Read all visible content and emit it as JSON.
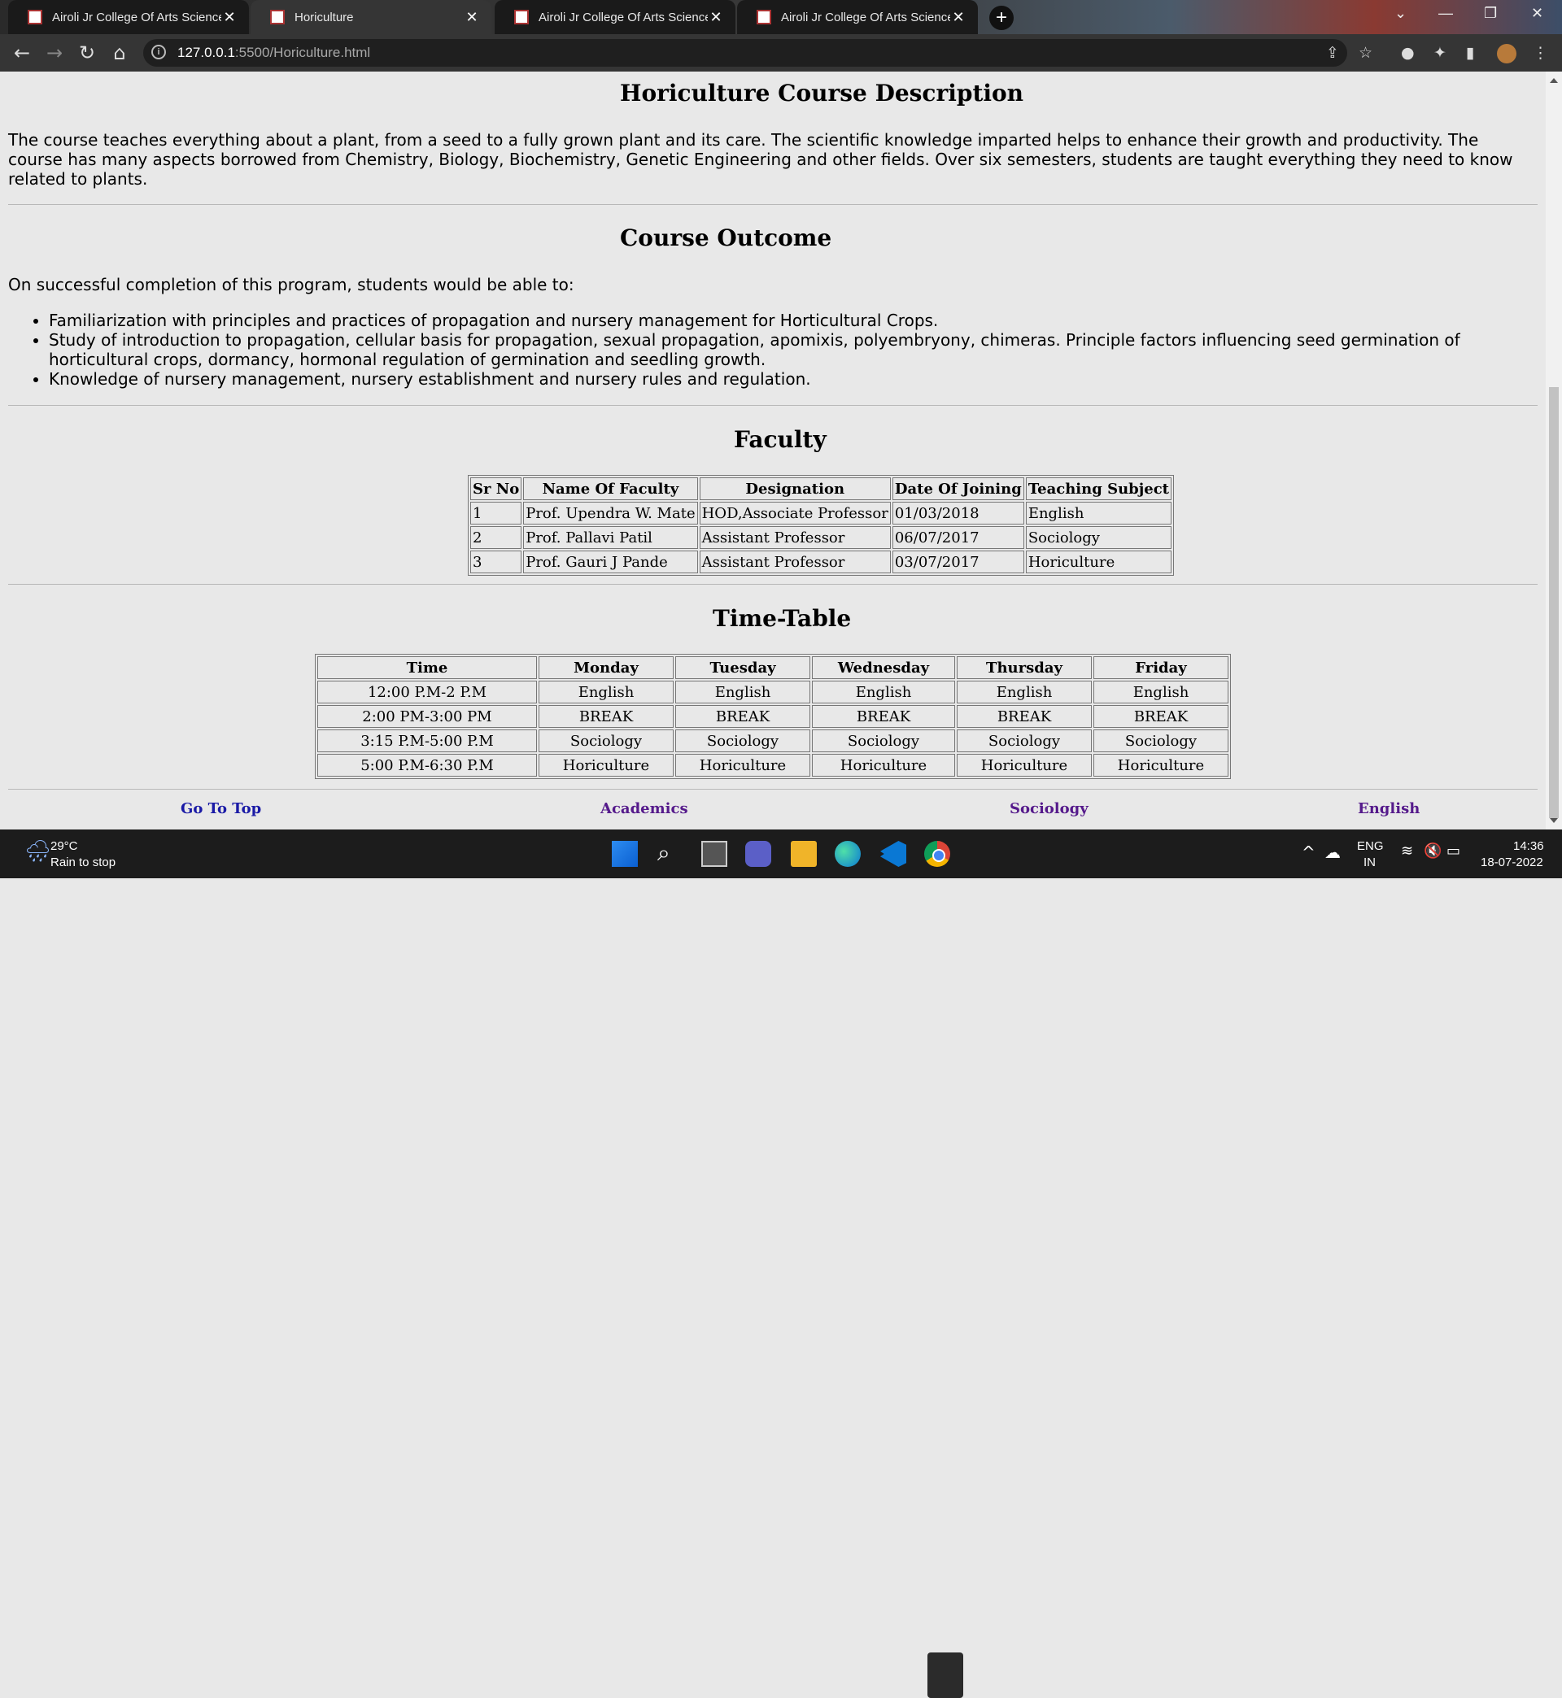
{
  "browser": {
    "tabs": [
      {
        "title": "Airoli Jr College Of Arts Science /",
        "active": false
      },
      {
        "title": "Horiculture",
        "active": true
      },
      {
        "title": "Airoli Jr College Of Arts Science /",
        "active": false
      },
      {
        "title": "Airoli Jr College Of Arts Science /",
        "active": false
      }
    ],
    "url_host": "127.0.0.1",
    "url_rest": ":5500/Horiculture.html"
  },
  "description": {
    "heading": "Horiculture Course Description",
    "text": "The course teaches everything about a plant, from a seed to a fully grown plant and its care. The scientific knowledge imparted helps to enhance their growth and productivity. The course has many aspects borrowed from Chemistry, Biology, Biochemistry, Genetic Engineering and other fields. Over six semesters, students are taught everything they need to know related to plants."
  },
  "outcome": {
    "heading": "Course Outcome",
    "intro": "On successful completion of this program, students would be able to:",
    "items": [
      "Familiarization with principles and practices of propagation and nursery management for Horticultural Crops.",
      "Study of introduction to propagation, cellular basis for propagation, sexual propagation, apomixis, polyembryony, chimeras. Principle factors influencing seed germination of horticultural crops, dormancy, hormonal regulation of germination and seedling growth.",
      "Knowledge of nursery management, nursery establishment and nursery rules and regulation."
    ]
  },
  "faculty": {
    "heading": "Faculty",
    "columns": [
      "Sr No",
      "Name Of Faculty",
      "Designation",
      "Date Of Joining",
      "Teaching Subject"
    ],
    "rows": [
      [
        "1",
        "Prof. Upendra W. Mate",
        "HOD,Associate Professor",
        "01/03/2018",
        "English"
      ],
      [
        "2",
        "Prof. Pallavi Patil",
        "Assistant Professor",
        "06/07/2017",
        "Sociology"
      ],
      [
        "3",
        "Prof. Gauri J Pande",
        "Assistant Professor",
        "03/07/2017",
        "Horiculture"
      ]
    ]
  },
  "timetable": {
    "heading": "Time-Table",
    "columns": [
      "Time",
      "Monday",
      "Tuesday",
      "Wednesday",
      "Thursday",
      "Friday"
    ],
    "rows": [
      [
        "12:00 P.M-2 P.M",
        "English",
        "English",
        "English",
        "English",
        "English"
      ],
      [
        "2:00 PM-3:00 PM",
        "BREAK",
        "BREAK",
        "BREAK",
        "BREAK",
        "BREAK"
      ],
      [
        "3:15 P.M-5:00 P.M",
        "Sociology",
        "Sociology",
        "Sociology",
        "Sociology",
        "Sociology"
      ],
      [
        "5:00 P.M-6:30 P.M",
        "Horiculture",
        "Horiculture",
        "Horiculture",
        "Horiculture",
        "Horiculture"
      ]
    ]
  },
  "footer": {
    "links": [
      "Go To Top",
      "Academics",
      "Sociology",
      "English"
    ]
  },
  "taskbar": {
    "weather_temp": "29°C",
    "weather_text": "Rain to stop",
    "lang_1": "ENG",
    "lang_2": "IN",
    "time": "14:36",
    "date": "18-07-2022"
  },
  "colors": {
    "page_bg": "#e8e8e8",
    "visited_link": "#551a8b",
    "link": "#1a1aa6"
  }
}
